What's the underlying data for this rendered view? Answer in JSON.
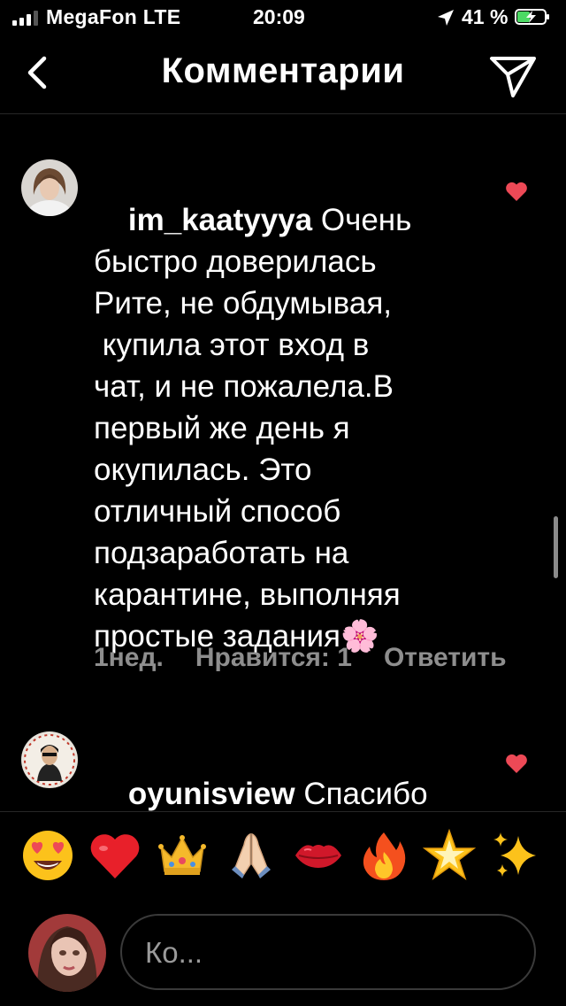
{
  "status": {
    "carrier": "MegaFon LTE",
    "time": "20:09",
    "battery": "41 %"
  },
  "header": {
    "title": "Комментарии"
  },
  "comments": [
    {
      "user": "im_kaatyyya",
      "text": "Очень\nбыстро доверилась\nРите, не обдумывая,\n купила этот вход в\nчат, и не пожалела.В\nпервый же день я\nокупилась. Это\nотличный способ\nподзаработать на\nкарантине, выполняя\nпростые задания🌸",
      "time": "1нед.",
      "likes": "Нравится: 1",
      "reply": "Ответить"
    },
    {
      "user": "oyunisview",
      "text": "Спасибо\nбольшое Рите за"
    }
  ],
  "emojis": [
    "😍",
    "❤️",
    "👑",
    "🙏",
    "💋",
    "🔥",
    "🌟",
    "✨"
  ],
  "input": {
    "placeholder": "Ко..."
  }
}
